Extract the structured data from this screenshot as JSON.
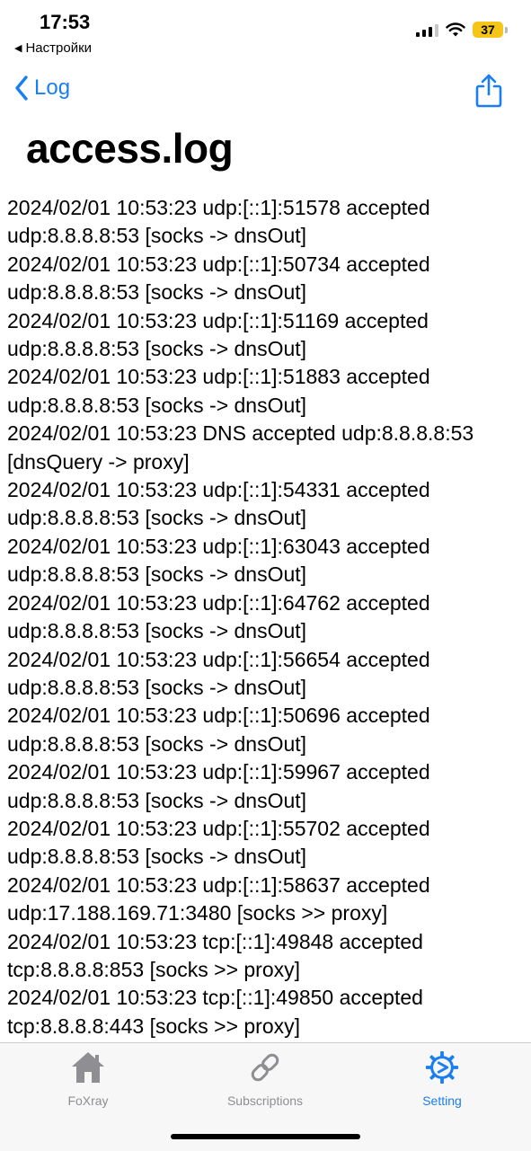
{
  "status_bar": {
    "time": "17:53",
    "back_app_label": "Настройки",
    "battery_level": "37"
  },
  "nav": {
    "back_label": "Log",
    "title": "access.log"
  },
  "log": {
    "entries": [
      [
        "2024/02/01 10:53:23 udp:[::1]:51578 accepted",
        "udp:8.8.8.8:53 [socks -> dnsOut]"
      ],
      [
        "2024/02/01 10:53:23 udp:[::1]:50734 accepted",
        "udp:8.8.8.8:53 [socks -> dnsOut]"
      ],
      [
        "2024/02/01 10:53:23 udp:[::1]:51169 accepted",
        "udp:8.8.8.8:53 [socks -> dnsOut]"
      ],
      [
        "2024/02/01 10:53:23 udp:[::1]:51883 accepted",
        "udp:8.8.8.8:53 [socks -> dnsOut]"
      ],
      [
        "2024/02/01 10:53:23 DNS accepted udp:8.8.8.8:53",
        "[dnsQuery -> proxy]"
      ],
      [
        "2024/02/01 10:53:23 udp:[::1]:54331 accepted",
        "udp:8.8.8.8:53 [socks -> dnsOut]"
      ],
      [
        "2024/02/01 10:53:23 udp:[::1]:63043 accepted",
        "udp:8.8.8.8:53 [socks -> dnsOut]"
      ],
      [
        "2024/02/01 10:53:23 udp:[::1]:64762 accepted",
        "udp:8.8.8.8:53 [socks -> dnsOut]"
      ],
      [
        "2024/02/01 10:53:23 udp:[::1]:56654 accepted",
        "udp:8.8.8.8:53 [socks -> dnsOut]"
      ],
      [
        "2024/02/01 10:53:23 udp:[::1]:50696 accepted",
        "udp:8.8.8.8:53 [socks -> dnsOut]"
      ],
      [
        "2024/02/01 10:53:23 udp:[::1]:59967 accepted",
        "udp:8.8.8.8:53 [socks -> dnsOut]"
      ],
      [
        "2024/02/01 10:53:23 udp:[::1]:55702 accepted",
        "udp:8.8.8.8:53 [socks -> dnsOut]"
      ],
      [
        "2024/02/01 10:53:23 udp:[::1]:58637 accepted",
        "udp:17.188.169.71:3480 [socks >> proxy]"
      ],
      [
        "2024/02/01 10:53:23 tcp:[::1]:49848 accepted",
        "tcp:8.8.8.8:853 [socks >> proxy]"
      ],
      [
        "2024/02/01 10:53:23 tcp:[::1]:49850 accepted",
        "tcp:8.8.8.8:443 [socks >> proxy]"
      ]
    ]
  },
  "tabs": [
    {
      "label": "FoXray",
      "icon": "home-icon",
      "active": false
    },
    {
      "label": "Subscriptions",
      "icon": "link-icon",
      "active": false
    },
    {
      "label": "Setting",
      "icon": "gear-icon",
      "active": true
    }
  ],
  "colors": {
    "accent": "#1a7ef0",
    "inactive_tab": "#8e8e93",
    "battery": "#f5c518"
  }
}
